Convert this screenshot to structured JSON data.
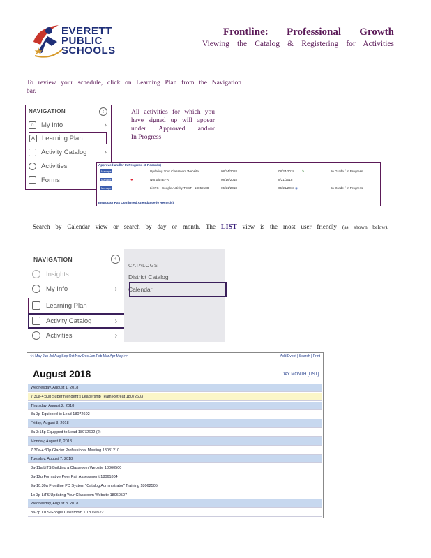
{
  "header": {
    "logo_line1": "EVERETT",
    "logo_line2": "PUBLIC",
    "logo_line3": "SCHOOLS",
    "title": "Frontline: Professional Growth",
    "subtitle": "Viewing the Catalog & Registering for Activities"
  },
  "intro": {
    "line1": "To review your schedule, click on Learning Plan from the Navigation",
    "line2": "bar."
  },
  "nav1": {
    "heading": "NAVIGATION",
    "items": [
      {
        "label": "My Info",
        "icon": "person-icon"
      },
      {
        "label": "Learning Plan",
        "icon": "plan-icon"
      },
      {
        "label": "Activity Catalog",
        "icon": "book-icon"
      },
      {
        "label": "Activities",
        "icon": "gear-icon"
      },
      {
        "label": "Forms",
        "icon": "forms-icon"
      }
    ]
  },
  "note": {
    "lines": [
      "All activities for which you",
      "have signed up will appear",
      "under Approved and/or",
      "In Progress"
    ]
  },
  "records": {
    "header": "Approved and/or In Progress (3 Records)",
    "rows": [
      {
        "badge": "Manage",
        "title": "Updating Your Classroom Website",
        "date1": "08/24/2018",
        "date2": "08/24/2018",
        "status": "In Grade / In Progress"
      },
      {
        "badge": "Manage",
        "title": "Not with EFR",
        "date1": "08/16/2018",
        "date2": "8/21/2018",
        "status": ""
      },
      {
        "badge": "Manage",
        "title": "LiSTS - Google Activity TEST - 18052188",
        "date1": "05/21/2018",
        "date2": "05/21/2018",
        "status": "In Grade / In Progress"
      }
    ],
    "footer": "Instructor Has Confirmed Attendance (0 Records)"
  },
  "search_line": {
    "part1": "Search by Calendar view or search by day or month. The",
    "list_word": "LIST",
    "part2": "view is the most user friendly",
    "part3": "(as shown below)."
  },
  "nav2": {
    "heading": "NAVIGATION",
    "items": [
      {
        "label": "Insights",
        "icon": "bulb-icon"
      },
      {
        "label": "My Info",
        "icon": "person-icon"
      },
      {
        "label": "Learning Plan",
        "icon": "plan-icon"
      },
      {
        "label": "Activity Catalog",
        "icon": "book-icon"
      },
      {
        "label": "Activities",
        "icon": "gear-icon"
      }
    ],
    "catalogs_heading": "CATALOGS",
    "catalog_items": [
      "District Catalog",
      "Calendar"
    ]
  },
  "calendar": {
    "months_nav": "<< May Jun Jul Aug Sep Oct Nov Dec Jan Feb Mar Apr May >>",
    "top_right": "Add Event | Search | Print",
    "month": "August 2018",
    "views": "DAY MONTH [LIST]",
    "rows": [
      {
        "kind": "day",
        "text": "Wednesday, August 1, 2018"
      },
      {
        "kind": "ev hl",
        "text": "7:30a-4:30p Superintendent's Leadership Team Retreat 18072603"
      },
      {
        "kind": "day",
        "text": "Thursday, August 2, 2018"
      },
      {
        "kind": "ev",
        "text": "8a-3p Equipped to Lead 18072602"
      },
      {
        "kind": "day",
        "text": "Friday, August 3, 2018"
      },
      {
        "kind": "ev",
        "text": "8a-3:15p Equipped to Lead 18072602 (2)"
      },
      {
        "kind": "day",
        "text": "Monday, August 6, 2018"
      },
      {
        "kind": "ev",
        "text": "7:30a-4:30p Glacier Professional Meeting 18081210"
      },
      {
        "kind": "day",
        "text": "Tuesday, August 7, 2018"
      },
      {
        "kind": "ev",
        "text": "8a-11a LiTS Building a Classroom Website 18060500"
      },
      {
        "kind": "ev",
        "text": "8a-12p Formative Peer Pair Assessment 18061804"
      },
      {
        "kind": "ev",
        "text": "9a-10:30a Frontline PD System \"Catalog Administrator\" Training 18062505"
      },
      {
        "kind": "ev",
        "text": "1p-3p LiTS Updating Your Classroom Website 18060507"
      },
      {
        "kind": "day",
        "text": "Wednesday, August 8, 2018"
      },
      {
        "kind": "ev",
        "text": "8a-3p LiTS Google Classroom 1 18060522"
      }
    ]
  },
  "colors": {
    "purple": "#5b1a58",
    "navy": "#1f2f78",
    "day_row": "#c7d8ef",
    "highlight_row": "#fbf6c8"
  }
}
